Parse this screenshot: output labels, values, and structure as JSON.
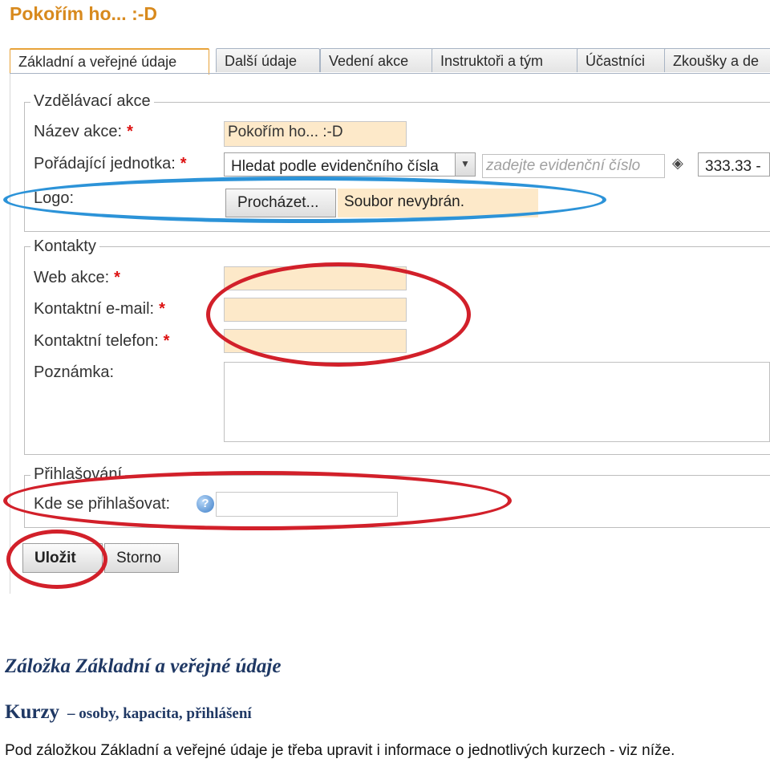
{
  "page_title": "Pokořím ho... :-D",
  "tabs": [
    {
      "label": "Základní a veřejné údaje",
      "active": true
    },
    {
      "label": "Další údaje",
      "active": false
    },
    {
      "label": "Vedení akce",
      "active": false
    },
    {
      "label": "Instruktoři a tým",
      "active": false
    },
    {
      "label": "Účastníci",
      "active": false
    },
    {
      "label": "Zkoušky a de",
      "active": false
    }
  ],
  "section_vzdelavaci": {
    "legend": "Vzdělávací akce",
    "nazev_label": "Název akce:",
    "nazev_value": "Pokořím ho... :-D",
    "jednotka_label": "Pořádající jednotka:",
    "jednotka_select_value": "Hledat podle evidenčního čísla",
    "jednotka_placeholder": "zadejte evidenční číslo",
    "jednotka_result": "333.33 -",
    "logo_label": "Logo:",
    "browse_label": "Procházet...",
    "file_status": "Soubor nevybrán."
  },
  "section_kontakty": {
    "legend": "Kontakty",
    "web_label": "Web akce:",
    "email_label": "Kontaktní e-mail:",
    "telefon_label": "Kontaktní telefon:",
    "poznamka_label": "Poznámka:"
  },
  "section_prihlasovani": {
    "legend": "Přihlašování",
    "kde_label": "Kde se přihlašovat:",
    "help_glyph": "?"
  },
  "required_mark": "*",
  "buttons": {
    "save_label": "Uložit",
    "cancel_label": "Storno"
  },
  "annotation_colors": {
    "blue": "#2c93d8",
    "red": "#d2202a"
  },
  "doc": {
    "heading": "Záložka Základní a veřejné údaje",
    "sub_big": "Kurzy",
    "sub_small": "– osoby, kapacita, přihlášení",
    "body": "Pod záložkou Základní a veřejné údaje je třeba upravit i informace o jednotlivých kurzech - viz níže."
  }
}
